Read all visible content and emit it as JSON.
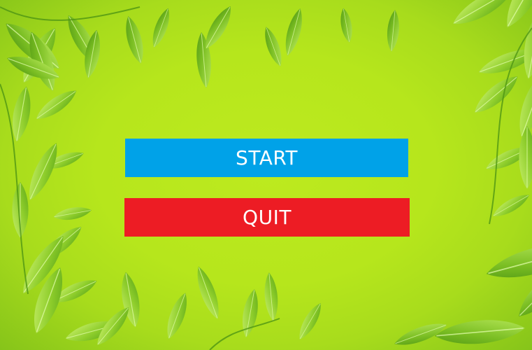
{
  "menu": {
    "start_label": "START",
    "quit_label": "QUIT"
  },
  "colors": {
    "background": "#b5e51e",
    "start_button": "#00a2e8",
    "quit_button": "#ed1c24",
    "button_text": "#ffffff",
    "leaf_dark": "#5ea819",
    "leaf_mid": "#79bd22",
    "leaf_light": "#9fd83a",
    "leaf_highlight": "#c8ef6a"
  },
  "background_decoration": "leaf-frame"
}
